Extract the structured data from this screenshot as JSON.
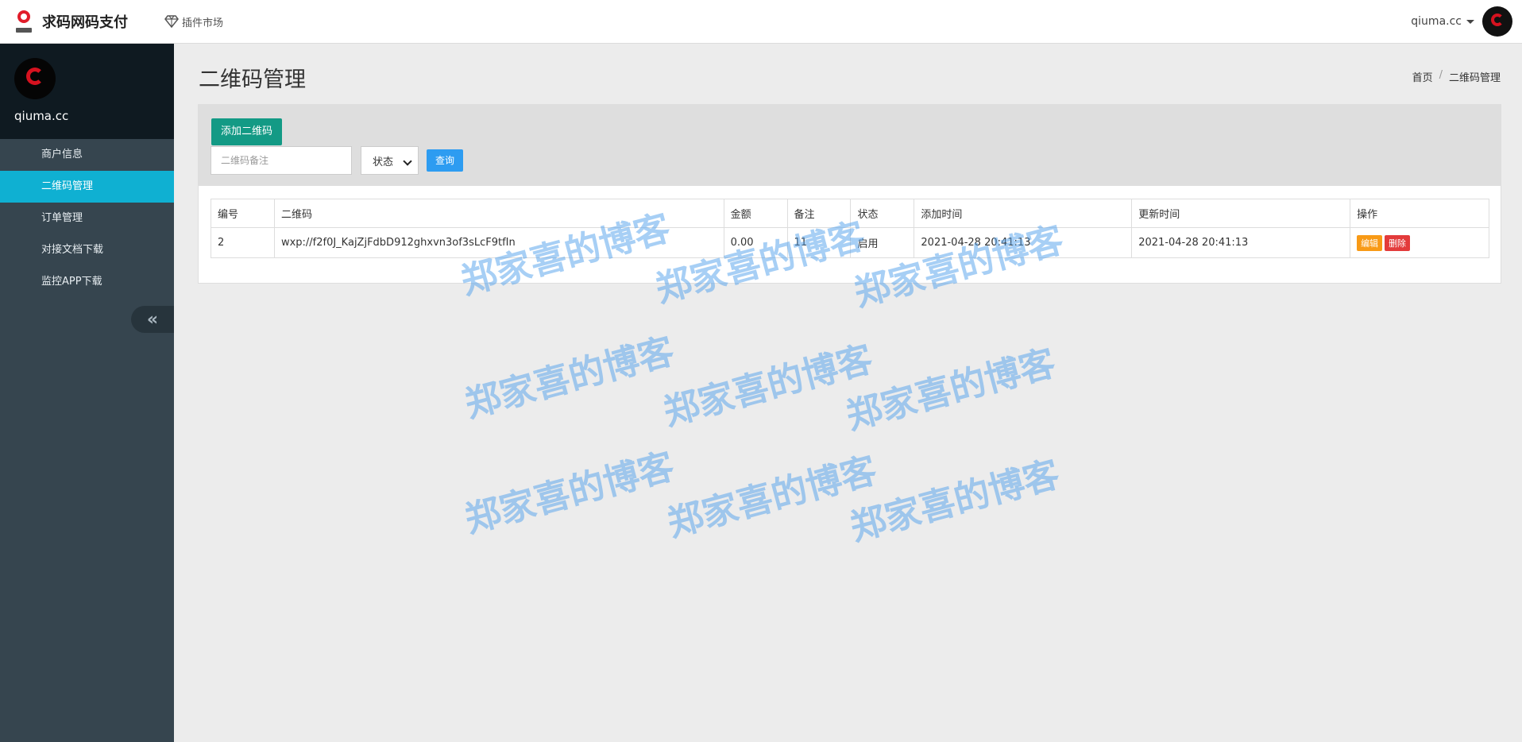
{
  "topbar": {
    "brand_title": "求码网码支付",
    "plugin_link": "插件市场",
    "user_name": "qiuma.cc"
  },
  "sidebar": {
    "profile_name": "qiuma.cc",
    "items": [
      {
        "label": "商户信息",
        "active": false
      },
      {
        "label": "二维码管理",
        "active": true
      },
      {
        "label": "订单管理",
        "active": false
      },
      {
        "label": "对接文档下载",
        "active": false
      },
      {
        "label": "监控APP下载",
        "active": false
      }
    ],
    "collapse_glyph": "«"
  },
  "page": {
    "title": "二维码管理",
    "breadcrumb": [
      "首页",
      "二维码管理"
    ],
    "breadcrumb_sep": "/"
  },
  "toolbar": {
    "add_label": "添加二维码",
    "remark_placeholder": "二维码备注",
    "status_selected": "状态",
    "query_label": "查询"
  },
  "table": {
    "headers": [
      "编号",
      "二维码",
      "金额",
      "备注",
      "状态",
      "添加时间",
      "更新时间",
      "操作"
    ],
    "rows": [
      {
        "id": "2",
        "qrcode": "wxp://f2f0J_KajZjFdbD912ghxvn3of3sLcF9tfIn",
        "amount": "0.00",
        "remark": "11",
        "status": "启用",
        "added": "2021-04-28 20:41:13",
        "updated": "2021-04-28 20:41:13",
        "edit_label": "编辑",
        "delete_label": "删除"
      }
    ]
  },
  "watermark": {
    "text": "郑家喜的博客",
    "color": "#50a0eb"
  },
  "colors": {
    "sidebar_bg": "#36454f",
    "sidebar_active": "#0fb0d2",
    "add_button": "#139a85",
    "query_button": "#2d9cf1",
    "edit_button": "#f89a16",
    "delete_button": "#e33b3b"
  }
}
